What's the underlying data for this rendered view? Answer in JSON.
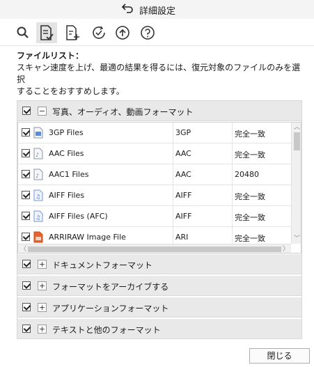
{
  "window": {
    "title": "詳細設定",
    "back_icon": "undo-arrow-icon"
  },
  "toolbar": {
    "icons": [
      "search-icon",
      "file-check-icon",
      "file-add-icon",
      "clock-check-icon",
      "cloud-up-icon",
      "help-icon"
    ],
    "active": "file-check-icon"
  },
  "description": {
    "heading": "ファイルリスト：",
    "line1": "スキャン速度を上げ、最適の結果を得るには、復元対象のファイルのみを選択",
    "line2": "することをおすすめします。"
  },
  "groups": [
    {
      "label": "写真、オーディオ、動画フォーマット",
      "expanded": true,
      "checked": true
    },
    {
      "label": "ドキュメントフォーマット",
      "expanded": false,
      "checked": true
    },
    {
      "label": "フォーマットをアーカイブする",
      "expanded": false,
      "checked": true
    },
    {
      "label": "アプリケーションフォーマット",
      "expanded": false,
      "checked": true
    },
    {
      "label": "テキストと他のフォーマット",
      "expanded": false,
      "checked": true
    }
  ],
  "files": [
    {
      "name": "3GP Files",
      "ext": "3GP",
      "match": "完全一致",
      "icon": "video-file-icon"
    },
    {
      "name": "AAC Files",
      "ext": "AAC",
      "match": "完全一致",
      "icon": "audio-file-icon"
    },
    {
      "name": "AAC1 Files",
      "ext": "AAC",
      "match": "20480",
      "icon": "audio-file-icon"
    },
    {
      "name": "AIFF Files",
      "ext": "AIFF",
      "match": "完全一致",
      "icon": "music-file-icon"
    },
    {
      "name": "AIFF Files (AFC)",
      "ext": "AIFF",
      "match": "完全一致",
      "icon": "music-file-icon"
    },
    {
      "name": "ARRIRAW Image File",
      "ext": "ARI",
      "match": "完全一致",
      "icon": "image-file-icon"
    }
  ],
  "buttons": {
    "close": "閉じる"
  },
  "colors": {
    "group_bg": "#e9e9e9",
    "image_icon": "#e8622a"
  }
}
